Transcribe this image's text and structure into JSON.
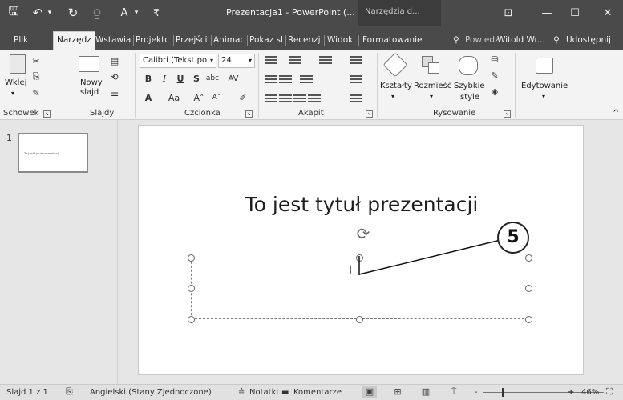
{
  "titlebar": {
    "title": "Prezentacja1 - PowerPoint (...",
    "context_tab": "Narzędzia d...",
    "icons": [
      "save-icon",
      "undo-icon",
      "redo-icon",
      "start-from-beginning-icon",
      "font-icon",
      "customize-icon"
    ],
    "save_glyph": "🖫",
    "undo_glyph": "↶",
    "redo_glyph": "↻",
    "slideshow_glyph": "⍜",
    "font_glyph": "A",
    "dropdown_glyph": "▾",
    "customize_glyph": "₹",
    "ribbon_display_glyph": "⊡",
    "minimize_glyph": "—",
    "maximize_glyph": "☐",
    "close_glyph": "✕"
  },
  "tabs": {
    "items": [
      {
        "label": "Plik",
        "active": false
      },
      {
        "label": "Narzędz",
        "active": true
      },
      {
        "label": "Wstawia",
        "active": false
      },
      {
        "label": "Projektc",
        "active": false
      },
      {
        "label": "Przejści",
        "active": false
      },
      {
        "label": "Animac",
        "active": false
      },
      {
        "label": "Pokaz sl",
        "active": false
      },
      {
        "label": "Recenzj",
        "active": false
      },
      {
        "label": "Widok",
        "active": false
      },
      {
        "label": "Formatowanie",
        "active": false
      }
    ],
    "tellme": "Powiedz",
    "user": "Witold Wr...",
    "share": "Udostępnij",
    "tellme_glyph": "♀",
    "share_glyph": "⚲"
  },
  "ribbon": {
    "clipboard": {
      "paste": "Wklej",
      "label": "Schowek"
    },
    "slides": {
      "new_slide_line1": "Nowy",
      "new_slide_line2": "slajd",
      "label": "Slajdy"
    },
    "font": {
      "font_name": "Calibri (Tekst po",
      "font_size": "24",
      "bold": "B",
      "italic": "I",
      "underline": "U",
      "shadow": "S",
      "strike": "abc",
      "spacing": "AV",
      "font_color": "A",
      "change_case": "Aa",
      "grow": "A˄",
      "shrink": "A˅",
      "label": "Czcionka"
    },
    "paragraph": {
      "label": "Akapit"
    },
    "drawing": {
      "shapes": "Kształty",
      "arrange": "Rozmieść",
      "quick_styles_line1": "Szybkie",
      "quick_styles_line2": "style",
      "label": "Rysowanie"
    },
    "editing": {
      "label": "Edytowanie"
    },
    "dropdown_glyph": "▾",
    "launcher_glyph": "↘",
    "collapse_glyph": "^"
  },
  "thumbnails": [
    {
      "number": "1",
      "text": "To jest tytuł prezentacji"
    }
  ],
  "slide": {
    "title": "To jest tytuł prezentacji",
    "rotate_glyph": "⟳",
    "cursor_glyph": "I"
  },
  "callout": {
    "number": "5"
  },
  "statusbar": {
    "slide_info": "Slajd 1 z 1",
    "language": "Angielski (Stany Zjednoczone)",
    "notes": "Notatki",
    "comments": "Komentarze",
    "zoom": "46%",
    "zoom_minus": "-",
    "zoom_plus": "+",
    "spell_glyph": "⎘",
    "notes_glyph": "≙",
    "comments_glyph": "▬",
    "normal_view_glyph": "▣",
    "sorter_glyph": "⊞",
    "reading_glyph": "▥",
    "slideshow_glyph": "⍑",
    "fit_glyph": "⛶"
  }
}
